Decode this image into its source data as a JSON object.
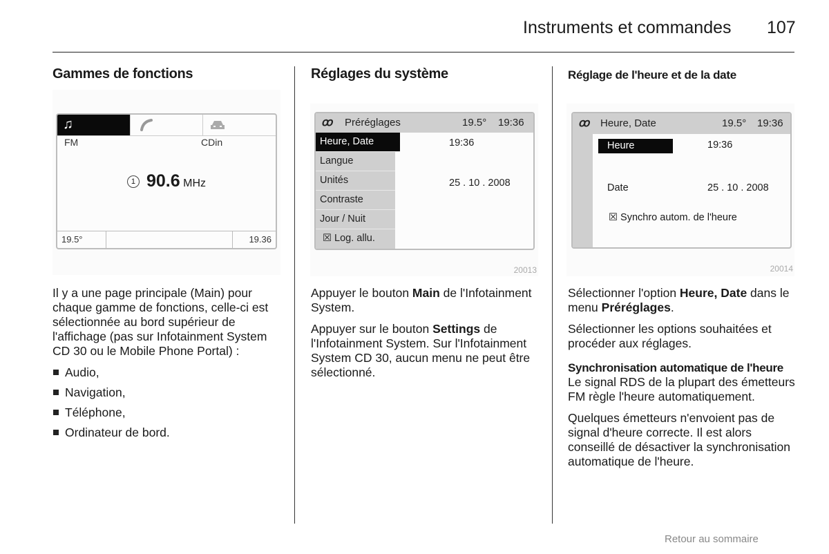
{
  "header": {
    "title": "Instruments et commandes",
    "page_number": "107"
  },
  "columns": [
    {
      "heading": "Gammes de fonctions",
      "screen": {
        "tabs": [
          {
            "icon": "music-note-icon",
            "glyph": "♫",
            "active": true
          },
          {
            "icon": "phone-icon",
            "glyph": "✆",
            "active": false
          },
          {
            "icon": "car-icon",
            "glyph": "🚘",
            "active": false
          }
        ],
        "source_left": "FM",
        "source_right": "CDin",
        "preset_number": "1",
        "frequency": "90.6",
        "unit": "MHz",
        "status_temp": "19.5°",
        "status_time": "19.36"
      },
      "paragraph": "Il y a une page principale (Main) pour chaque gamme de fonctions, celle-ci est sélectionnée au bord supérieur de l'affichage (pas sur Infotainment System CD 30 ou le Mobile Phone Portal) :",
      "bullets": [
        "Audio,",
        "Navigation,",
        "Téléphone,",
        "Ordinateur de bord."
      ]
    },
    {
      "heading": "Réglages du système",
      "screen": {
        "title": "Préréglages",
        "temp": "19.5°",
        "time": "19:36",
        "menu": [
          "Heure, Date",
          "Langue",
          "Unités",
          "Contraste",
          "Jour / Nuit",
          "☒ Log. allu."
        ],
        "selected_index": 0,
        "value_time": "19:36",
        "value_date": "25 . 10 . 2008"
      },
      "figure_number": "20013",
      "p1_pre": "Appuyer le bouton ",
      "p1_bold": "Main",
      "p1_post": " de l'Infotainment System.",
      "p2_pre": "Appuyer sur le bouton ",
      "p2_bold": "Settings",
      "p2_post": " de l'Infotainment System. Sur l'Infotainment System CD 30, aucun menu ne peut être sélectionné."
    },
    {
      "heading": "Réglage de l'heure et de la date",
      "screen": {
        "title": "Heure, Date",
        "temp": "19.5°",
        "time": "19:36",
        "row1_label": "Heure",
        "row1_value": "19:36",
        "row2_label": "Date",
        "row2_value": "25 . 10 . 2008",
        "checkbox_label": "Synchro autom. de l'heure",
        "checkbox_checked": true
      },
      "figure_number": "20014",
      "p1_pre": "Sélectionner l'option ",
      "p1_bold1": "Heure, Date",
      "p1_mid": " dans le menu ",
      "p1_bold2": "Préréglages",
      "p1_post": ".",
      "p2": "Sélectionner les options souhaitées et procéder aux réglages.",
      "subheading": "Synchronisation automatique de l'heure",
      "p3": "Le signal RDS de la plupart des émetteurs FM règle l'heure automatiquement.",
      "p4": "Quelques émetteurs n'envoient pas de signal d'heure correcte. Il est alors conseillé de désactiver la synchronisation automatique de l'heure."
    }
  ],
  "footer": {
    "link": "Retour au sommaire"
  }
}
